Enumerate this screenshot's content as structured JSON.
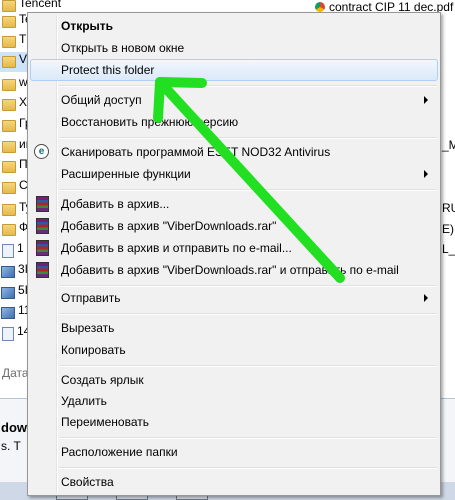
{
  "background": {
    "top_item": "Tencent",
    "top_right_tab": "contract CIP 11 dec.pdf",
    "left_items": [
      "Te",
      "Th",
      "Vi",
      "w",
      "Xe",
      "Гр",
      "иг",
      "П",
      "CA",
      "Ту",
      "Ф",
      "1",
      "3I",
      "5I",
      "11",
      "14"
    ],
    "date_label": "Дата",
    "right_fragments": [
      "_M",
      "RU",
      "L_",
      "E)"
    ],
    "bottom_title": "dow",
    "bottom_text": "s. T"
  },
  "menu": {
    "open": "Открыть",
    "open_new_window": "Открыть в новом окне",
    "protect_folder": "Protect this folder",
    "share": "Общий доступ",
    "restore_prev": "Восстановить прежнюю версию",
    "scan_eset": "Сканировать программой ESET NOD32 Antivirus",
    "extended": "Расширенные функции",
    "add_archive": "Добавить в архив...",
    "add_viber_rar": "Добавить в архив \"ViberDownloads.rar\"",
    "add_email": "Добавить в архив и отправить по e-mail...",
    "add_viber_email": "Добавить в архив \"ViberDownloads.rar\" и отправить по e-mail",
    "send_to": "Отправить",
    "cut": "Вырезать",
    "copy": "Копировать",
    "shortcut": "Создать ярлык",
    "delete": "Удалить",
    "rename": "Переименовать",
    "folder_location": "Расположение папки",
    "properties": "Свойства"
  },
  "colors": {
    "arrow": "#22e021",
    "highlight_border": "#aecff7"
  },
  "icons": {
    "eset": "eset-icon",
    "rar": "winrar-icon",
    "submenu": "chevron-right-icon"
  }
}
